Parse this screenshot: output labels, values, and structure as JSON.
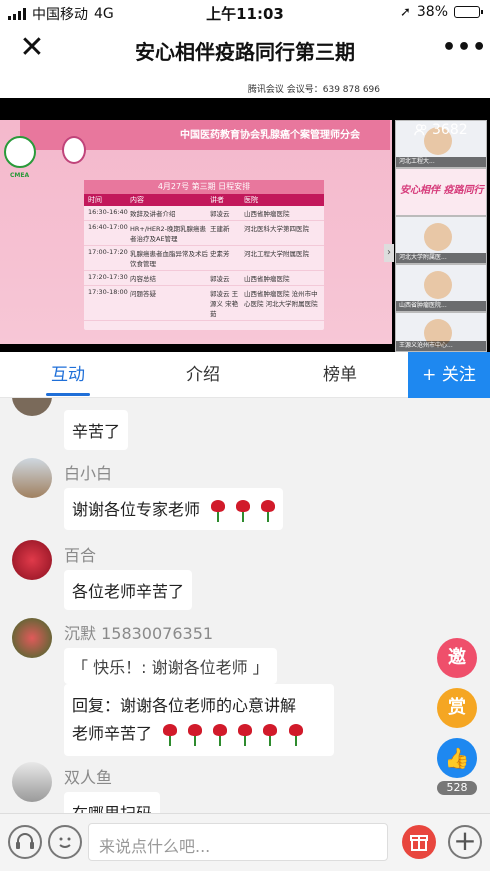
{
  "status_bar": {
    "carrier": "中国移动",
    "network": "4G",
    "time": "上午11:03",
    "battery_percent": "38%",
    "battery_level": 0.38,
    "battery_color": "#3cc83c"
  },
  "nav": {
    "title": "安心相伴疫路同行第三期",
    "close_icon": "close-icon",
    "more_icon": "more-icon"
  },
  "video": {
    "meeting_label": "腾讯会议 会议号：639 878 696",
    "viewer_count": "3682",
    "slide": {
      "banner": "中国医药教育协会乳腺癌个案管理师分会",
      "logo_text": "CMEA",
      "schedule_title": "4月27号 第三期 日程安排",
      "columns": [
        "时间",
        "内容",
        "讲者",
        "医院"
      ],
      "rows": [
        [
          "16:30-16:40",
          "致辞及讲者介绍",
          "郭凌云",
          "山西省肿瘤医院"
        ],
        [
          "16:40-17:00",
          "HR+/HER2-晚期乳腺癌患者治疗及AE管理",
          "王建新",
          "河北医科大学第四医院"
        ],
        [
          "17:00-17:20",
          "乳腺癌患者血脂异常及术后饮食管理",
          "史素芳",
          "河北工程大学附属医院"
        ],
        [
          "17:20-17:30",
          "内容总结",
          "郭凌云",
          "山西省肿瘤医院"
        ],
        [
          "17:30-18:00",
          "问题答疑",
          "郭凌云 王源义 宋艳茹",
          "山西省肿瘤医院 沧州市中心医院 河北大学附属医院"
        ]
      ]
    },
    "thumbs": [
      {
        "caption": "河北工程大...",
        "type": "face"
      },
      {
        "caption": "安心相伴 疫路同行",
        "type": "brand"
      },
      {
        "caption": "河北大学附属医...",
        "type": "face"
      },
      {
        "caption": "山西省肿瘤医院...",
        "type": "face"
      },
      {
        "caption": "王源义沧州市中心...",
        "type": "face"
      }
    ]
  },
  "tabs": {
    "items": [
      "互动",
      "介绍",
      "榜单"
    ],
    "active": 0,
    "follow_label": "+ 关注"
  },
  "chat": {
    "messages": [
      {
        "user": "",
        "text": "辛苦了",
        "roses": 0
      },
      {
        "user": "白小白",
        "text": "谢谢各位专家老师",
        "roses": 3
      },
      {
        "user": "百合",
        "text": "各位老师辛苦了",
        "roses": 0
      },
      {
        "user": "沉默 15830076351",
        "quote": "「 快乐！: 谢谢各位老师 」",
        "text_line1": "回复：谢谢各位老师的心意讲解",
        "text_line2": "老师辛苦了",
        "roses": 6
      },
      {
        "user": "双人鱼",
        "text": "在哪里扫码",
        "roses": 0
      }
    ]
  },
  "side_buttons": {
    "invite_label": "邀",
    "reward_label": "赏",
    "like_count": "528",
    "invite_color": "#ef4f6b",
    "reward_color": "#f5a623",
    "like_color": "#1e88f0"
  },
  "bottom_bar": {
    "placeholder": "来说点什么吧...",
    "headset_icon": "headset-icon",
    "emoji_icon": "emoji-icon",
    "gift_icon": "gift-icon",
    "plus_icon": "plus-icon"
  }
}
